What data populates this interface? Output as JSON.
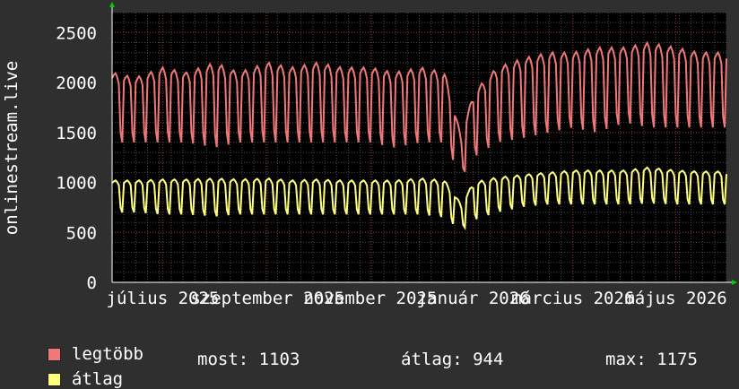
{
  "chart_data": {
    "type": "line",
    "ylabel": "onlinestream.live",
    "ylim": [
      0,
      2700
    ],
    "yticks": [
      0,
      500,
      1000,
      1500,
      2000,
      2500
    ],
    "ytick_labels": [
      "0",
      "500",
      "1000",
      "1500",
      "2000",
      "2500"
    ],
    "xlim": [
      "2025-06-01",
      "2026-05-31"
    ],
    "xtick_labels": [
      {
        "label": "július 2025",
        "date": "2025-07-01"
      },
      {
        "label": "szeptember 2025",
        "date": "2025-09-01"
      },
      {
        "label": "november 2025",
        "date": "2025-11-01"
      },
      {
        "label": "január 2026",
        "date": "2026-01-01"
      },
      {
        "label": "március 2026",
        "date": "2026-03-01"
      },
      {
        "label": "május 2026",
        "date": "2026-05-01"
      }
    ],
    "grid": true,
    "series": [
      {
        "name": "legtöbb",
        "color": "#f07878",
        "x": [
          "2025-06-01",
          "2025-06-15",
          "2025-07-01",
          "2025-07-15",
          "2025-08-01",
          "2025-08-15",
          "2025-09-01",
          "2025-09-15",
          "2025-10-01",
          "2025-10-15",
          "2025-11-01",
          "2025-11-15",
          "2025-12-01",
          "2025-12-15",
          "2025-12-25",
          "2026-01-01",
          "2026-01-15",
          "2026-02-01",
          "2026-02-15",
          "2026-03-01",
          "2026-03-15",
          "2026-04-01",
          "2026-04-15",
          "2026-05-01",
          "2026-05-15",
          "2026-05-31"
        ],
        "peak": [
          2100,
          2050,
          2150,
          2100,
          2200,
          2100,
          2200,
          2150,
          2200,
          2150,
          2150,
          2100,
          2150,
          2100,
          1450,
          1900,
          2150,
          2250,
          2300,
          2300,
          2350,
          2350,
          2400,
          2350,
          2300,
          2300
        ],
        "trough": [
          1400,
          1400,
          1400,
          1400,
          1350,
          1400,
          1400,
          1400,
          1400,
          1400,
          1400,
          1350,
          1400,
          1400,
          1050,
          1250,
          1400,
          1450,
          1500,
          1550,
          1500,
          1600,
          1550,
          1550,
          1550,
          1550
        ]
      },
      {
        "name": "átlag",
        "color": "#ffff80",
        "x": [
          "2025-06-01",
          "2025-06-15",
          "2025-07-01",
          "2025-07-15",
          "2025-08-01",
          "2025-08-15",
          "2025-09-01",
          "2025-09-15",
          "2025-10-01",
          "2025-10-15",
          "2025-11-01",
          "2025-11-15",
          "2025-12-01",
          "2025-12-15",
          "2025-12-25",
          "2026-01-01",
          "2026-01-15",
          "2026-02-01",
          "2026-02-15",
          "2026-03-01",
          "2026-03-15",
          "2026-04-01",
          "2026-04-15",
          "2026-05-01",
          "2026-05-15",
          "2026-05-31"
        ],
        "peak": [
          1020,
          1020,
          1030,
          1030,
          1040,
          1030,
          1040,
          1020,
          1030,
          1020,
          1020,
          1020,
          1040,
          1020,
          780,
          1000,
          1050,
          1080,
          1100,
          1120,
          1120,
          1120,
          1150,
          1120,
          1110,
          1110
        ],
        "trough": [
          700,
          700,
          680,
          680,
          660,
          680,
          680,
          680,
          680,
          680,
          680,
          680,
          680,
          650,
          520,
          620,
          700,
          760,
          780,
          780,
          780,
          780,
          790,
          780,
          780,
          780
        ]
      }
    ]
  },
  "legend": {
    "items": [
      {
        "label": "legtöbb",
        "color": "#f07878"
      },
      {
        "label": "átlag",
        "color": "#ffff80"
      }
    ],
    "stats": {
      "now_label": "most: 1103",
      "avg_label": "átlag: 944",
      "max_label": "max: 1175"
    }
  },
  "colors": {
    "background": "#2f2f2f",
    "plot_background": "#000000",
    "grid_minor": "#4a4a4a",
    "grid_major": "#8a3030",
    "axis_arrow": "#00cc00"
  }
}
